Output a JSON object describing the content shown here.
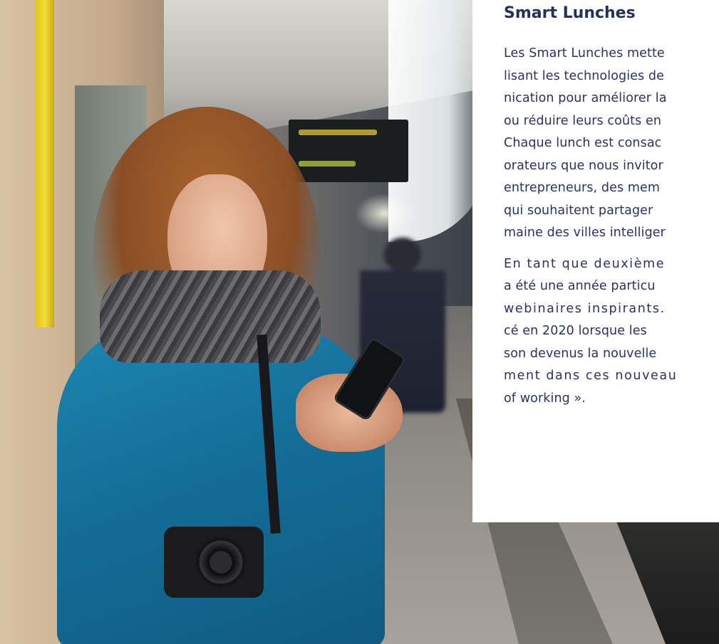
{
  "section": {
    "title": "Smart Lunches",
    "paragraph1_lines": [
      "Les Smart Lunches mette",
      "lisant les technologies de",
      "nication pour améliorer la",
      "ou réduire leurs coûts en",
      "Chaque lunch est consac",
      "orateurs que nous invitor",
      "entrepreneurs, des mem",
      "qui souhaitent partager",
      "maine des villes intelliger"
    ],
    "paragraph2_lines": [
      "En tant que deuxième",
      "a été une année particu",
      "webinaires inspirants.",
      "cé en 2020 lorsque les",
      "son devenus la nouvelle",
      "ment dans ces nouveau",
      "of working »."
    ]
  },
  "colors": {
    "heading": "#26305e",
    "body_text": "#2a3166",
    "card_background": "#ffffff"
  }
}
